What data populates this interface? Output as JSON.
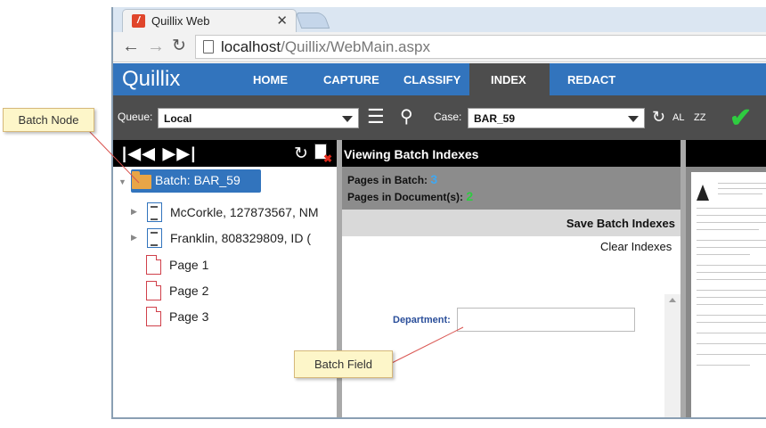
{
  "browser": {
    "tab_title": "Quillix Web",
    "url_host": "localhost",
    "url_path": "/Quillix/WebMain.aspx"
  },
  "app": {
    "brand": "Quillix",
    "nav": [
      "HOME",
      "CAPTURE",
      "CLASSIFY",
      "INDEX",
      "REDACT"
    ],
    "active_nav": "INDEX"
  },
  "queuebar": {
    "queue_label": "Queue:",
    "queue_value": "Local",
    "case_label": "Case:",
    "case_value": "BAR_59",
    "al_label": "AL",
    "zz_label": "ZZ"
  },
  "tree": {
    "nav_glyphs": "|◀◀ ▶▶|",
    "batch": "Batch: BAR_59",
    "documents": [
      "McCorkle, 127873567, NM",
      "Franklin, 808329809, ID ("
    ],
    "pages": [
      "Page 1",
      "Page 2",
      "Page 3"
    ]
  },
  "middle": {
    "title": "Viewing Batch Indexes",
    "pages_in_batch_label": "Pages in Batch:",
    "pages_in_batch": "3",
    "pages_in_docs_label": "Pages in Document(s):",
    "pages_in_docs": "2",
    "save_label": "Save Batch Indexes",
    "clear_label": "Clear Indexes",
    "department_label": "Department:",
    "department_value": ""
  },
  "callouts": {
    "batch_node": "Batch Node",
    "batch_field": "Batch Field"
  },
  "colors": {
    "appbar": "#3274bd",
    "dark_bar": "#4d4d4d",
    "accent_green": "#2ecc40",
    "accent_blue": "#3fa8f2"
  }
}
